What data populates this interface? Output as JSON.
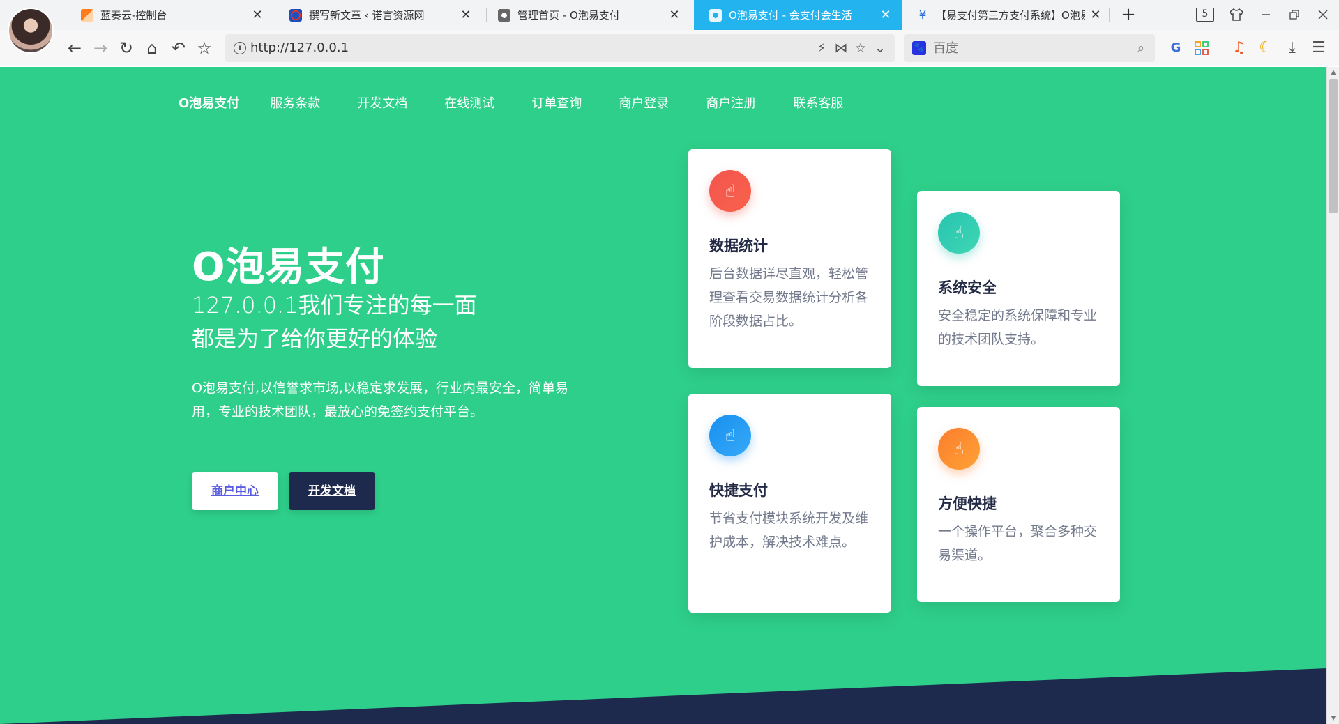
{
  "browser": {
    "tabs": [
      {
        "title": "蓝奏云-控制台",
        "favicon": "lanzou-icon",
        "active": false
      },
      {
        "title": "撰写新文章 ‹ 诺言资源网",
        "favicon": "nuoyan-icon",
        "active": false
      },
      {
        "title": "管理首页 - O泡易支付",
        "favicon": "globe-icon",
        "active": false
      },
      {
        "title": "O泡易支付 - 会支付会生活",
        "favicon": "globe-icon",
        "active": true
      },
      {
        "title": "【易支付第三方支付系统】O泡易",
        "favicon": "deer-icon",
        "active": false
      }
    ],
    "tab_close": "✕",
    "new_tab": "+",
    "tab_count": "5",
    "url": "http://127.0.0.1",
    "search_engine": "百度",
    "search_placeholder": "百度",
    "accent_color": "#23b3ef"
  },
  "page": {
    "nav": {
      "brand": "O泡易支付",
      "items": [
        "服务条款",
        "开发文档",
        "在线测试",
        "订单查询",
        "商户登录",
        "商户注册",
        "联系客服"
      ]
    },
    "hero": {
      "title": "O泡易支付",
      "subtitle_line1": "127.0.0.1我们专注的每一面",
      "subtitle_line2": "都是为了给你更好的体验",
      "description": "O泡易支付,以信誉求市场,以稳定求发展，行业内最安全，简单易用，专业的技术团队，最放心的免签约支付平台。",
      "btn_merchant": "商户中心",
      "btn_docs": "开发文档"
    },
    "features": [
      {
        "title": "数据统计",
        "text": "后台数据详尽直观，轻松管理查看交易数据统计分析各阶段数据占比。",
        "icon": "hand-pointer-icon",
        "color": "#f2554e"
      },
      {
        "title": "系统安全",
        "text": "安全稳定的系统保障和专业的技术团队支持。",
        "icon": "hand-pointer-icon",
        "color": "#27c4b0"
      },
      {
        "title": "快捷支付",
        "text": "节省支付模块系统开发及维护成本，解决技术难点。",
        "icon": "hand-pointer-icon",
        "color": "#1890f0"
      },
      {
        "title": "方便快捷",
        "text": "一个操作平台，聚合多种交易渠道。",
        "icon": "hand-pointer-icon",
        "color": "#fb7d2d"
      }
    ],
    "background_color": "#2ecf8a",
    "dark_color": "#1d2a4d"
  }
}
